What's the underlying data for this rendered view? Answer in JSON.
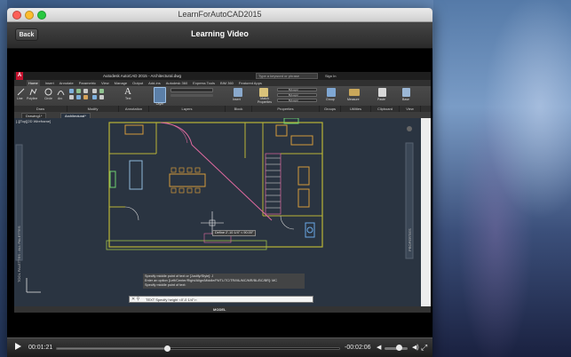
{
  "window": {
    "title": "LearnForAutoCAD2015"
  },
  "appbar": {
    "back_label": "Back",
    "title": "Learning Video"
  },
  "autocad": {
    "title": "Autodesk AutoCAD 2015 - Architectural.dwg",
    "search_placeholder": "Type a keyword or phrase",
    "signin": "Sign In",
    "menu_tabs": [
      "Home",
      "Insert",
      "Annotate",
      "Parametric",
      "View",
      "Manage",
      "Output",
      "Add-ins",
      "Autodesk 360",
      "Express Tools",
      "BIM 360",
      "Featured Apps"
    ],
    "ribbon_groups": [
      "Draw",
      "Modify",
      "Annotation",
      "Layers",
      "Block",
      "Properties",
      "Groups",
      "Utilities",
      "Clipboard",
      "View"
    ],
    "ribbon_tools": {
      "line": "Line",
      "polyline": "Polyline",
      "circle": "Circle",
      "arc": "Arc",
      "text": "Text",
      "layer_properties": "Layer Properties",
      "insert": "Insert",
      "match_properties": "Match Properties",
      "group": "Group",
      "measure": "Measure",
      "paste": "Paste",
      "base": "Base",
      "bylayer": "ByLayer"
    },
    "doc_tabs": [
      "Drawing1*",
      "Architectural*"
    ],
    "viewport_label": "[-][Top][2D Wireframe]",
    "side_palette": "TOOL PALETTES - ALL PALETTES",
    "properties_palette": "PROPERTIES",
    "tooltip": "Define 2'-10 1/4\" < 90.00°",
    "command_history": [
      "Specify middle point of text or [Justify/Style]: J",
      "Enter an option [Left/Center/Right/Align/Middle/Fit/TL/TC/TR/ML/MC/MR/BL/BC/BR]: MC",
      "Specify middle point of text:"
    ],
    "command_line": "TEXT Specify height <0'-0 1/4\">:",
    "model_label": "MODEL"
  },
  "player": {
    "elapsed": "00:01:21",
    "remaining": "-00:02:06",
    "progress": 0.39,
    "volume": 0.6
  }
}
